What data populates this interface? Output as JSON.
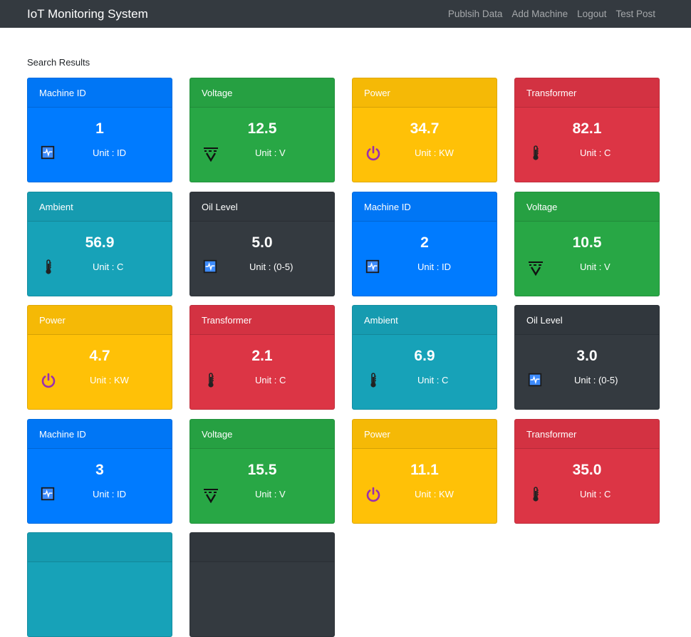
{
  "navbar": {
    "brand": "IoT Monitoring System",
    "links": [
      "Publsih Data",
      "Add Machine",
      "Logout",
      "Test Post"
    ]
  },
  "search_label": "Search Results",
  "cards": [
    {
      "title": "Machine ID",
      "value": "1",
      "unit": "Unit : ID",
      "color": "primary",
      "icon": "activity-icon"
    },
    {
      "title": "Voltage",
      "value": "12.5",
      "unit": "Unit : V",
      "color": "success",
      "icon": "voltage-icon"
    },
    {
      "title": "Power",
      "value": "34.7",
      "unit": "Unit : KW",
      "color": "warning",
      "icon": "power-icon"
    },
    {
      "title": "Transformer",
      "value": "82.1",
      "unit": "Unit : C",
      "color": "danger",
      "icon": "thermometer-icon"
    },
    {
      "title": "Ambient",
      "value": "56.9",
      "unit": "Unit : C",
      "color": "info",
      "icon": "thermometer-icon"
    },
    {
      "title": "Oil Level",
      "value": "5.0",
      "unit": "Unit : (0-5)",
      "color": "dark",
      "icon": "activity-icon"
    },
    {
      "title": "Machine ID",
      "value": "2",
      "unit": "Unit : ID",
      "color": "primary",
      "icon": "activity-icon"
    },
    {
      "title": "Voltage",
      "value": "10.5",
      "unit": "Unit : V",
      "color": "success",
      "icon": "voltage-icon"
    },
    {
      "title": "Power",
      "value": "4.7",
      "unit": "Unit : KW",
      "color": "warning",
      "icon": "power-icon"
    },
    {
      "title": "Transformer",
      "value": "2.1",
      "unit": "Unit : C",
      "color": "danger",
      "icon": "thermometer-icon"
    },
    {
      "title": "Ambient",
      "value": "6.9",
      "unit": "Unit : C",
      "color": "info",
      "icon": "thermometer-icon"
    },
    {
      "title": "Oil Level",
      "value": "3.0",
      "unit": "Unit : (0-5)",
      "color": "dark",
      "icon": "activity-icon"
    },
    {
      "title": "Machine ID",
      "value": "3",
      "unit": "Unit : ID",
      "color": "primary",
      "icon": "activity-icon"
    },
    {
      "title": "Voltage",
      "value": "15.5",
      "unit": "Unit : V",
      "color": "success",
      "icon": "voltage-icon"
    },
    {
      "title": "Power",
      "value": "11.1",
      "unit": "Unit : KW",
      "color": "warning",
      "icon": "power-icon"
    },
    {
      "title": "Transformer",
      "value": "35.0",
      "unit": "Unit : C",
      "color": "danger",
      "icon": "thermometer-icon"
    },
    {
      "title": "",
      "value": "",
      "unit": "",
      "color": "info",
      "icon": ""
    },
    {
      "title": "",
      "value": "",
      "unit": "",
      "color": "dark",
      "icon": ""
    }
  ]
}
